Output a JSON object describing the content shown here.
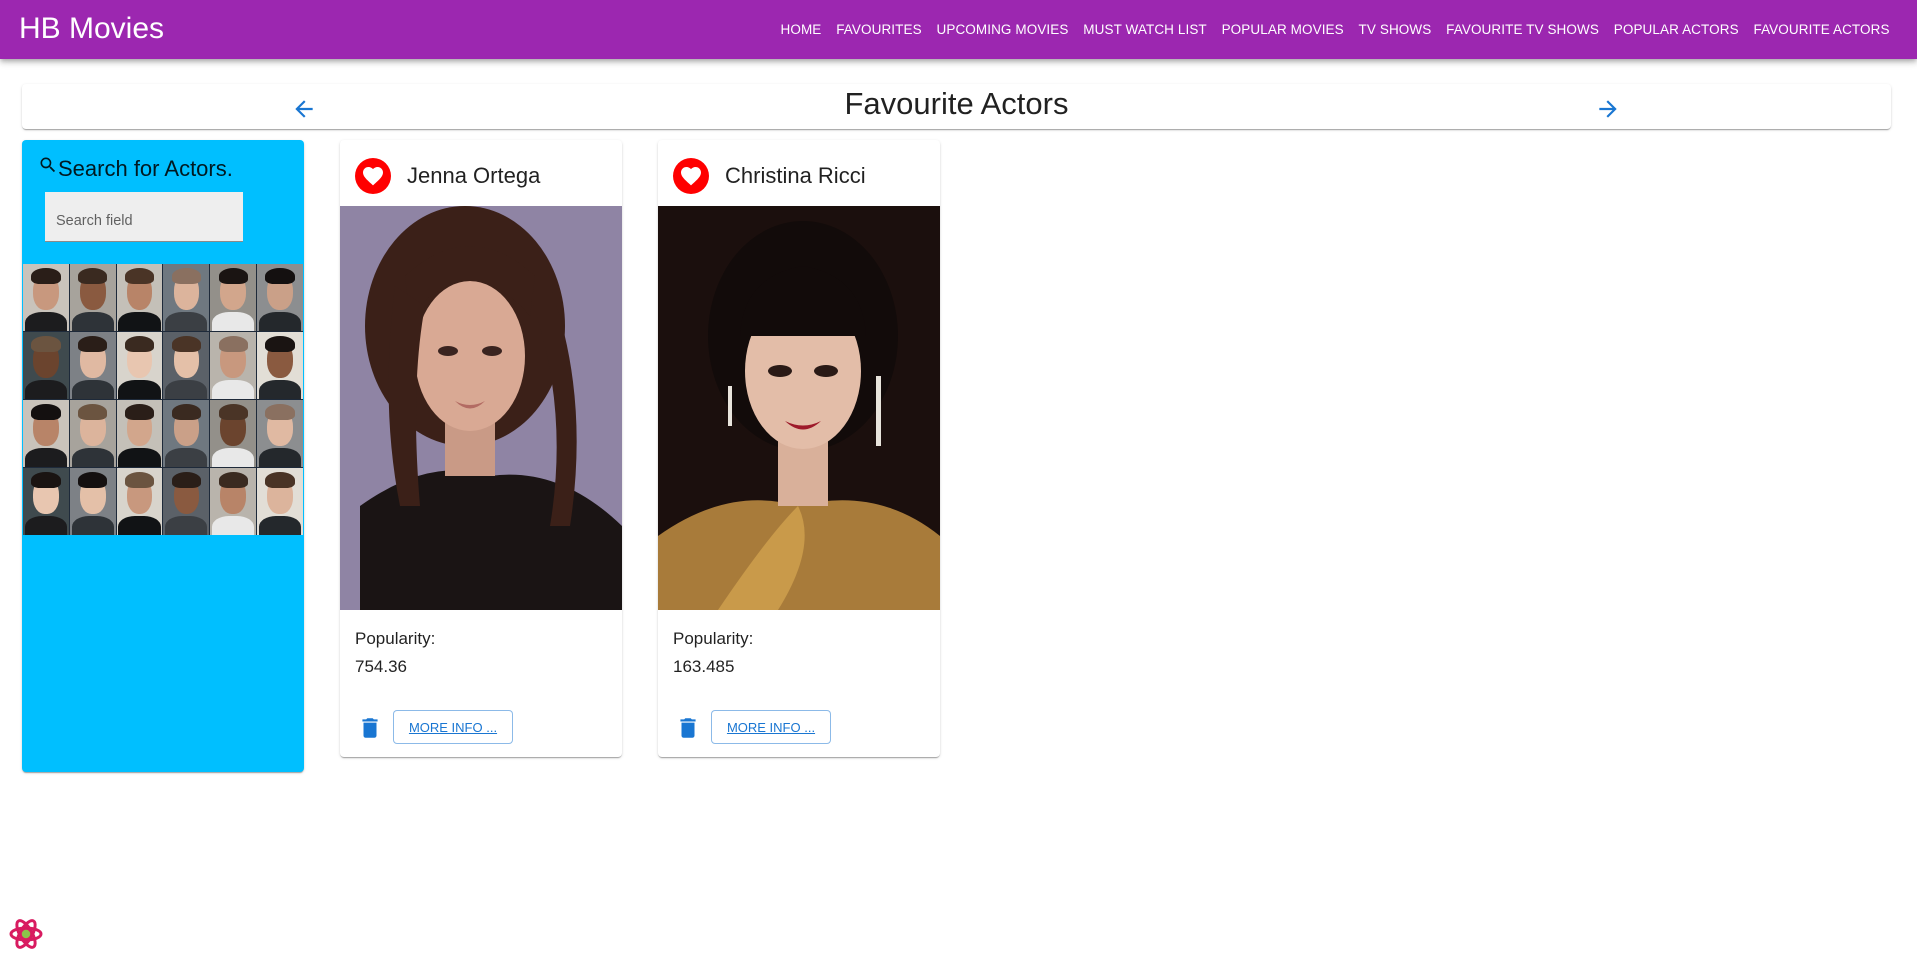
{
  "appbar": {
    "brand": "HB Movies",
    "color": "#9c27b0",
    "nav": [
      "HOME",
      "FAVOURITES",
      "UPCOMING MOVIES",
      "MUST WATCH LIST",
      "POPULAR MOVIES",
      "TV SHOWS",
      "FAVOURITE TV SHOWS",
      "POPULAR ACTORS",
      "FAVOURITE ACTORS"
    ]
  },
  "header": {
    "title": "Favourite Actors",
    "back_icon": "arrow-back-icon",
    "forward_icon": "arrow-forward-icon"
  },
  "sidebar": {
    "color": "#00bfff",
    "search_title": "Search for Actors.",
    "search_icon": "search-icon",
    "search_placeholder": "Search field",
    "search_value": "",
    "actor_thumbnails": 24
  },
  "cards": [
    {
      "name": "Jenna Ortega",
      "popularity_label": "Popularity:",
      "popularity": "754.36",
      "more_info_label": "MORE INFO ...",
      "favourite_icon": "heart-icon",
      "delete_icon": "trash-icon"
    },
    {
      "name": "Christina Ricci",
      "popularity_label": "Popularity:",
      "popularity": "163.485",
      "more_info_label": "MORE INFO ...",
      "favourite_icon": "heart-icon",
      "delete_icon": "trash-icon"
    }
  ],
  "devtools": {
    "icon": "react-devtools-icon"
  }
}
